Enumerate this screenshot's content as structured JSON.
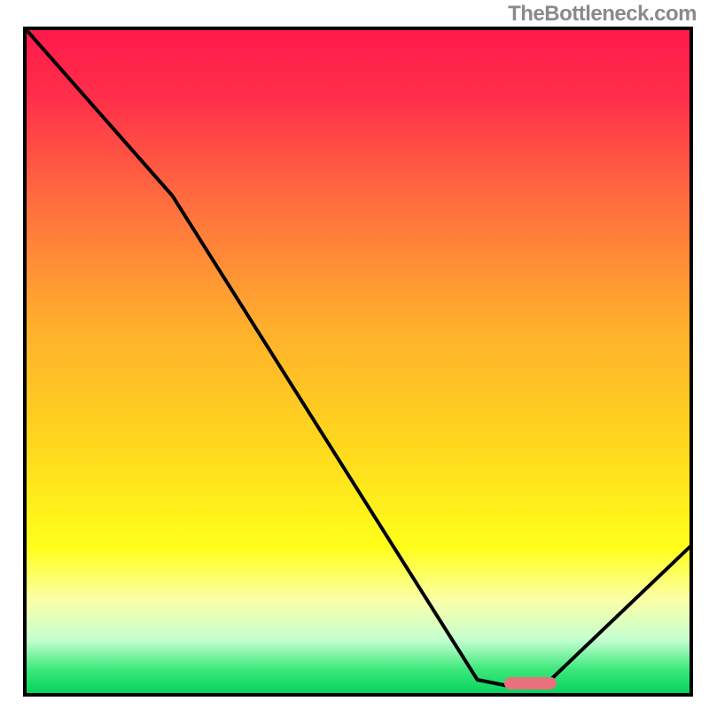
{
  "watermark": "TheBottleneck.com",
  "chart_data": {
    "type": "line",
    "title": "",
    "xlabel": "",
    "ylabel": "",
    "xlim": [
      0,
      100
    ],
    "ylim": [
      0,
      100
    ],
    "series": [
      {
        "name": "bottleneck-curve",
        "x": [
          0,
          22,
          68,
          73,
          78,
          100
        ],
        "values": [
          100,
          75,
          2,
          1,
          1,
          22
        ]
      }
    ],
    "annotations": [
      {
        "name": "optimal-marker",
        "x_start": 72,
        "x_end": 80,
        "y": 1.5
      }
    ],
    "gradient_stops": [
      {
        "pos": 0.0,
        "color": "#ff1a4b"
      },
      {
        "pos": 0.1,
        "color": "#ff2e4a"
      },
      {
        "pos": 0.25,
        "color": "#ff6a3f"
      },
      {
        "pos": 0.45,
        "color": "#ffb02c"
      },
      {
        "pos": 0.62,
        "color": "#ffd61e"
      },
      {
        "pos": 0.78,
        "color": "#ffff1a"
      },
      {
        "pos": 0.86,
        "color": "#fbffa8"
      },
      {
        "pos": 0.92,
        "color": "#c4ffd0"
      },
      {
        "pos": 0.965,
        "color": "#3be87a"
      },
      {
        "pos": 1.0,
        "color": "#07d35e"
      }
    ],
    "marker_color": "#e9717e",
    "curve_color": "#000000"
  }
}
